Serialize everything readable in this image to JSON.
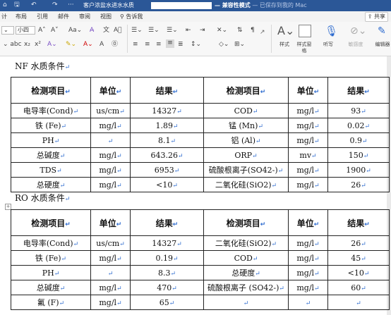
{
  "titlebar": {
    "quick_access": [
      "⌂",
      "🖫",
      "↶",
      "↷",
      "···"
    ],
    "doc_title": "客户浓盐水进水水质",
    "mode": "— 兼容性模式",
    "saved": "— 已保存到我的 Mac"
  },
  "tabs": [
    "计",
    "布局",
    "引用",
    "邮件",
    "审阅",
    "视图",
    "告诉我"
  ],
  "share_label": "共享",
  "ribbon": {
    "font_size": "小四",
    "labels": {
      "style": "样式",
      "style_pane": "样式窗格",
      "dictate": "听写",
      "sensitivity": "敏感度",
      "editor": "编辑器"
    }
  },
  "nf": {
    "heading": "NF 水质条件",
    "headers": [
      "检测项目",
      "单位",
      "结果",
      "检测项目",
      "单位",
      "结果"
    ],
    "rows": [
      [
        "电导率(Cond)",
        "us/cm",
        "14327",
        "COD",
        "mg/l",
        "93"
      ],
      [
        "铁 (Fe)",
        "mg/l",
        "1.89",
        "锰 (Mn)",
        "mg/l",
        "0.02"
      ],
      [
        "PH",
        "",
        "8.1",
        "铝 (Al)",
        "mg/l",
        "0.9"
      ],
      [
        "总碱度",
        "mg/l",
        "643.26",
        "ORP",
        "mv",
        "150"
      ],
      [
        "TDS",
        "mg/l",
        "6953",
        "硫酸根离子(SO42-)",
        "mg/l",
        "1900"
      ],
      [
        "总硬度",
        "mg/l",
        "<10",
        "二氧化硅(SiO2)",
        "mg/l",
        "26"
      ]
    ]
  },
  "ro": {
    "heading": "RO 水质条件",
    "headers": [
      "检测项目",
      "单位",
      "结果",
      "检测项目",
      "单位",
      "结果"
    ],
    "rows": [
      [
        "电导率(Cond)",
        "us/cm",
        "14327",
        "二氧化硅(SiO2)",
        "mg/l",
        "26"
      ],
      [
        "铁 (Fe)",
        "mg/l",
        "0.19",
        "COD",
        "mg/l",
        "45"
      ],
      [
        "PH",
        "",
        "8.3",
        "总硬度",
        "mg/l",
        "<10"
      ],
      [
        "总碱度",
        "mg/l",
        "470",
        "硫酸根离子 (SO42-)",
        "mg/l",
        "60"
      ],
      [
        "氟 (F)",
        "mg/l",
        "65",
        "",
        "",
        ""
      ]
    ]
  }
}
